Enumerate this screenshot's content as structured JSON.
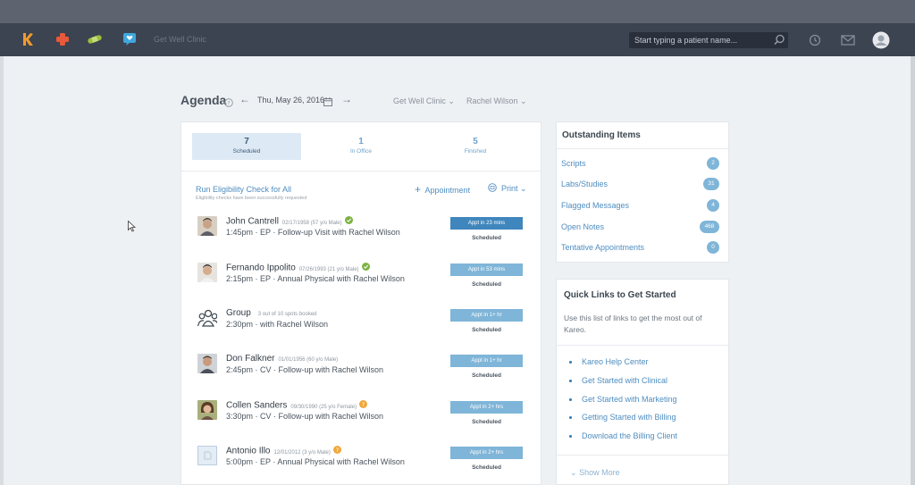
{
  "nav": {
    "clinic_name": "Get Well Clinic",
    "search_placeholder": "Start typing a patient name...",
    "icons": [
      "kareo-logo-icon",
      "medical-cross-icon",
      "bandage-icon",
      "heart-chat-icon",
      "search-icon",
      "history-icon",
      "mail-icon",
      "user-avatar-icon"
    ]
  },
  "agenda": {
    "title": "Agenda",
    "date": "Thu, May 26, 2016",
    "location": "Get Well Clinic",
    "provider": "Rachel Wilson",
    "tabs": [
      {
        "count": "7",
        "label": "Scheduled"
      },
      {
        "count": "1",
        "label": "In Office"
      },
      {
        "count": "5",
        "label": "Finished"
      }
    ],
    "eligibility_link": "Run Eligibility Check for All",
    "eligibility_sub": "Eligibility checks have been successfully requested",
    "appointment_label": "Appointment",
    "print_label": "Print"
  },
  "appointments": [
    {
      "name": "John Cantrell",
      "meta": "02/17/1958 (57 y/o Male)",
      "status": "verified",
      "desc": "1:45pm · EP · Follow-up Visit with Rachel Wilson",
      "badge": "Appt in 23 mins",
      "state": "Scheduled"
    },
    {
      "name": "Fernando Ippolito",
      "meta": "07/26/1993 (21 y/o Male)",
      "status": "verified",
      "desc": "2:15pm · EP · Annual Physical with Rachel Wilson",
      "badge": "Appt in 53 mins",
      "state": "Scheduled"
    },
    {
      "name": "Group",
      "meta": "3 out of 10 spots booked",
      "status": "none",
      "desc": "2:30pm · with Rachel Wilson",
      "badge": "Appt in 1+ hr",
      "state": "Scheduled"
    },
    {
      "name": "Don Falkner",
      "meta": "01/01/1956 (60 y/o Male)",
      "status": "none",
      "desc": "2:45pm · CV · Follow-up with Rachel Wilson",
      "badge": "Appt in 1+ hr",
      "state": "Scheduled"
    },
    {
      "name": "Collen Sanders",
      "meta": "09/30/1990 (25 y/o Female)",
      "status": "warning",
      "desc": "3:30pm · CV · Follow-up with Rachel Wilson",
      "badge": "Appt in 2+ hrs",
      "state": "Scheduled"
    },
    {
      "name": "Antonio Illo",
      "meta": "12/01/2012 (3 y/o Male)",
      "status": "warning",
      "desc": "5:00pm · EP · Annual Physical with Rachel Wilson",
      "badge": "Appt in 2+ hrs",
      "state": "Scheduled"
    }
  ],
  "outstanding": {
    "title": "Outstanding Items",
    "items": [
      {
        "label": "Scripts",
        "count": "2"
      },
      {
        "label": "Labs/Studies",
        "count": "31"
      },
      {
        "label": "Flagged Messages",
        "count": "4"
      },
      {
        "label": "Open Notes",
        "count": "468"
      },
      {
        "label": "Tentative Appointments",
        "count": "0"
      }
    ]
  },
  "quick_links": {
    "title": "Quick Links to Get Started",
    "description": "Use this list of links to get the most out of Kareo.",
    "links": [
      "Kareo Help Center",
      "Get Started with Clinical",
      "Get Started with Marketing",
      "Getting Started with Billing",
      "Download the Billing Client"
    ],
    "show_more": "Show More"
  },
  "colors": {
    "navbar": "#3c4351",
    "accent": "#4f8dc0",
    "badge": "#7fb5d8",
    "badge_primary": "#3f86bd",
    "verified": "#7cb342",
    "warning": "#f0a83a"
  }
}
